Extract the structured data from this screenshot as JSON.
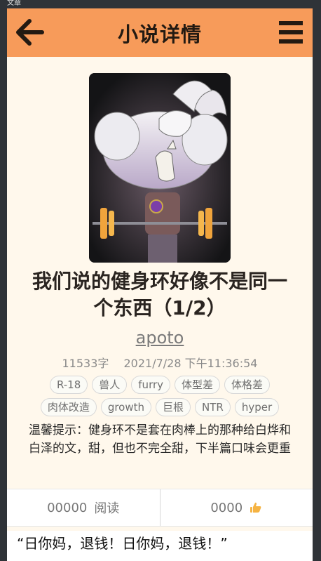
{
  "window": {
    "caption": "文章"
  },
  "header": {
    "title": "小说详情"
  },
  "novel": {
    "title": "我们说的健身环好像不是同一个东西（1/2）",
    "author": "apoto",
    "word_count": "11533字",
    "datetime": "2021/7/28 下午11:36:54",
    "tags": [
      "R-18",
      "兽人",
      "furry",
      "体型差",
      "体格差",
      "肉体改造",
      "growth",
      "巨根",
      "NTR",
      "hyper"
    ],
    "tip": "温馨提示：健身环不是套在肉棒上的那种给白烨和白泽的文，甜，但也不完全甜，下半篇口味会更重"
  },
  "stats": {
    "reads": "00000",
    "reads_label": "阅读",
    "likes": "0000"
  },
  "excerpt": "“日你妈，退钱！日你妈，退钱！”",
  "colors": {
    "header": "#f79b5a",
    "background": "#fff8ec",
    "accent": "#f5b342"
  },
  "icons": {
    "back": "arrow-left-icon",
    "menu": "hamburger-menu-icon",
    "like": "thumbs-up-icon"
  }
}
